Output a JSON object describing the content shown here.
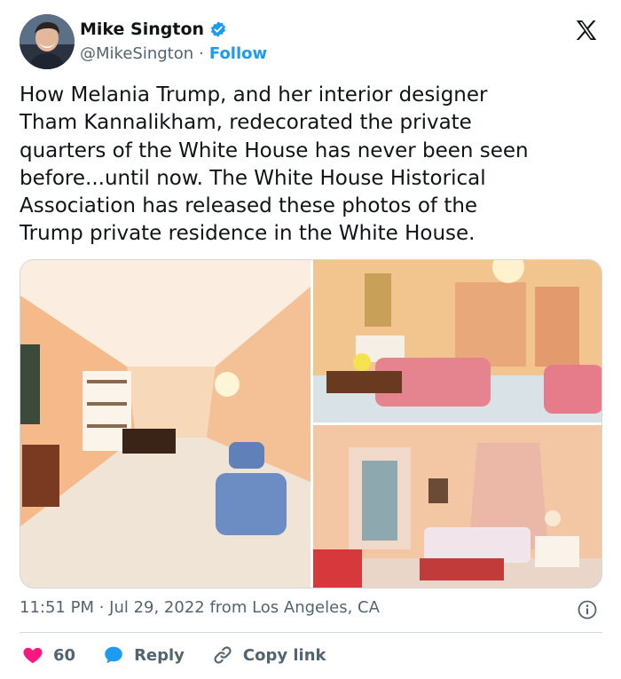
{
  "header": {
    "display_name": "Mike Sington",
    "handle": "@MikeSington",
    "separator": "·",
    "follow_label": "Follow"
  },
  "tweet": {
    "text": "How Melania Trump, and her interior designer\nTham Kannalikham, redecorated the private\nquarters of the White House has never been seen\nbefore...until now. The White House Historical\nAssociation has released these photos of the\nTrump private residence in the White House."
  },
  "meta": {
    "timestamp": "11:51 PM · Jul 29, 2022 from Los Angeles, CA"
  },
  "actions": {
    "likes": "60",
    "reply_label": "Reply",
    "copy_label": "Copy link"
  },
  "colors": {
    "accent": "#1d9bf0",
    "like": "#f91880",
    "text": "#0f1419",
    "muted": "#536471"
  },
  "icons": {
    "verified": "verified-badge-icon",
    "x": "x-logo-icon",
    "info": "info-icon",
    "like": "heart-icon",
    "reply": "speech-bubble-icon",
    "copy": "link-icon"
  }
}
